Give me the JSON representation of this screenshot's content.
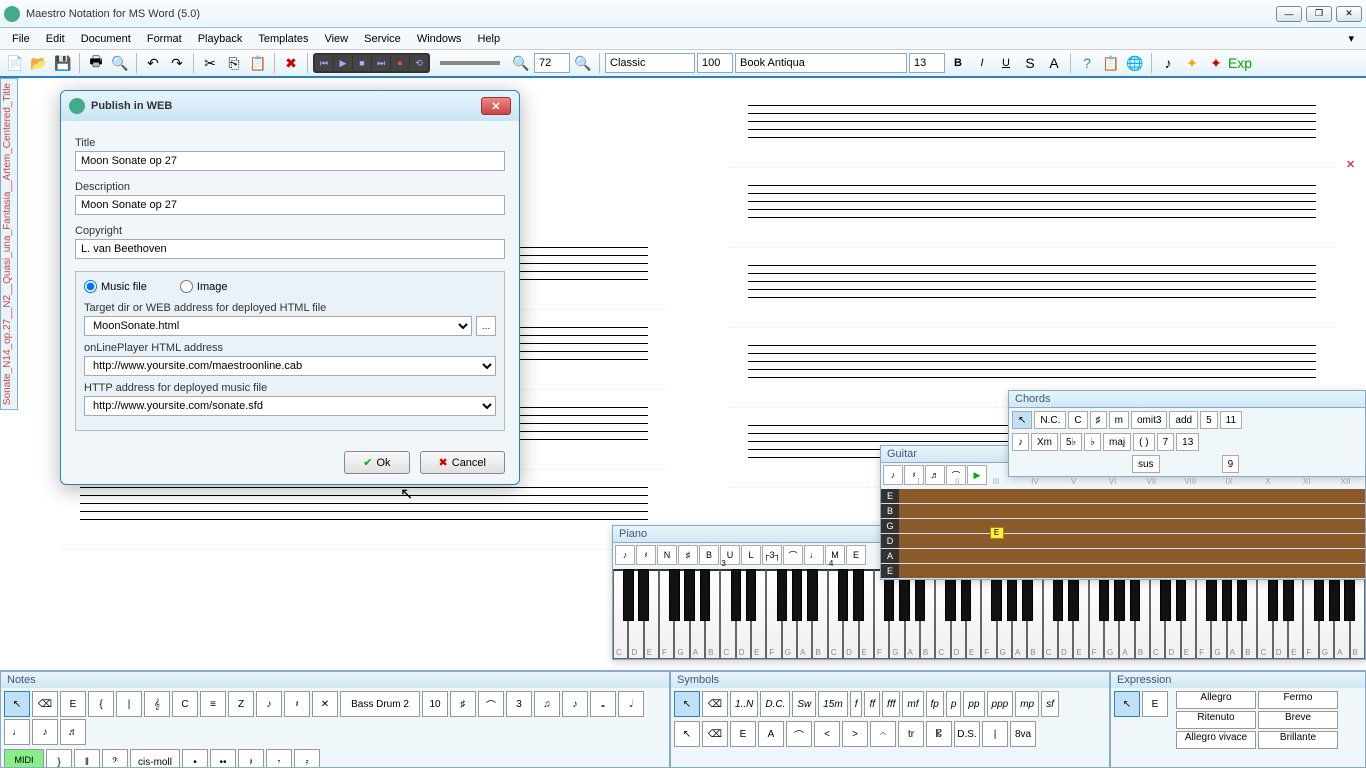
{
  "app": {
    "title": "Maestro Notation for MS Word (5.0)"
  },
  "menu": [
    "File",
    "Edit",
    "Document",
    "Format",
    "Playback",
    "Templates",
    "View",
    "Service",
    "Windows",
    "Help"
  ],
  "toolbar": {
    "zoom": "72",
    "style": "Classic",
    "scale": "100",
    "font": "Book Antiqua",
    "fontsize": "13"
  },
  "vtab": "Sonate_N14_op.27__N2__Quasi_una_Fantasia__Artem_Centered_Title",
  "composer": "L.van BEETHOVEN",
  "dialog": {
    "title": "Publish in WEB",
    "lbl_title": "Title",
    "title_val": "Moon Sonate op 27",
    "lbl_desc": "Description",
    "desc_val": "Moon Sonate op 27",
    "lbl_copy": "Copyright",
    "copy_val": "L. van Beethoven",
    "radio1": "Music file",
    "radio2": "Image",
    "lbl_target": "Target dir or WEB address for deployed HTML file",
    "target_val": "MoonSonate.html",
    "lbl_player": "onLinePlayer HTML address",
    "player_val": "http://www.yoursite.com/maestroonline.cab",
    "lbl_http": "HTTP address for deployed music file",
    "http_val": "http://www.yoursite.com/sonate.sfd",
    "ok": "Ok",
    "cancel": "Cancel"
  },
  "piano": {
    "title": "Piano",
    "oct3": "3",
    "oct4": "4",
    "notes": [
      "C",
      "D",
      "E",
      "F",
      "G",
      "A",
      "B"
    ]
  },
  "guitar": {
    "title": "Guitar",
    "strings": [
      "E",
      "B",
      "G",
      "D",
      "A",
      "E"
    ],
    "yellow": "E"
  },
  "chords": {
    "title": "Chords",
    "nc": "N.C.",
    "c": "C",
    "m": "m",
    "omit": "omit3",
    "add": "add",
    "maj": "maj",
    "sus": "sus",
    "n5": "5",
    "n7": "7",
    "n9": "9",
    "n11": "11",
    "n13": "13",
    "b": "♭",
    "sharp": "♯"
  },
  "notes_panel": {
    "title": "Notes",
    "midi": "MIDI",
    "bass": "Bass Drum 2",
    "key": "cis-moll",
    "n10": "10"
  },
  "symbols_panel": {
    "title": "Symbols",
    "items": [
      "1..N",
      "D.C.",
      "Sw",
      "15m",
      "f",
      "ff",
      "fff",
      "mf",
      "fp",
      "p",
      "pp",
      "ppp",
      "mp",
      "sf"
    ]
  },
  "expression": {
    "title": "Expression",
    "items": [
      "Allegro",
      "Fermo",
      "Ritenuto",
      "Breve",
      "Allegro vivace",
      "Brillante"
    ]
  }
}
